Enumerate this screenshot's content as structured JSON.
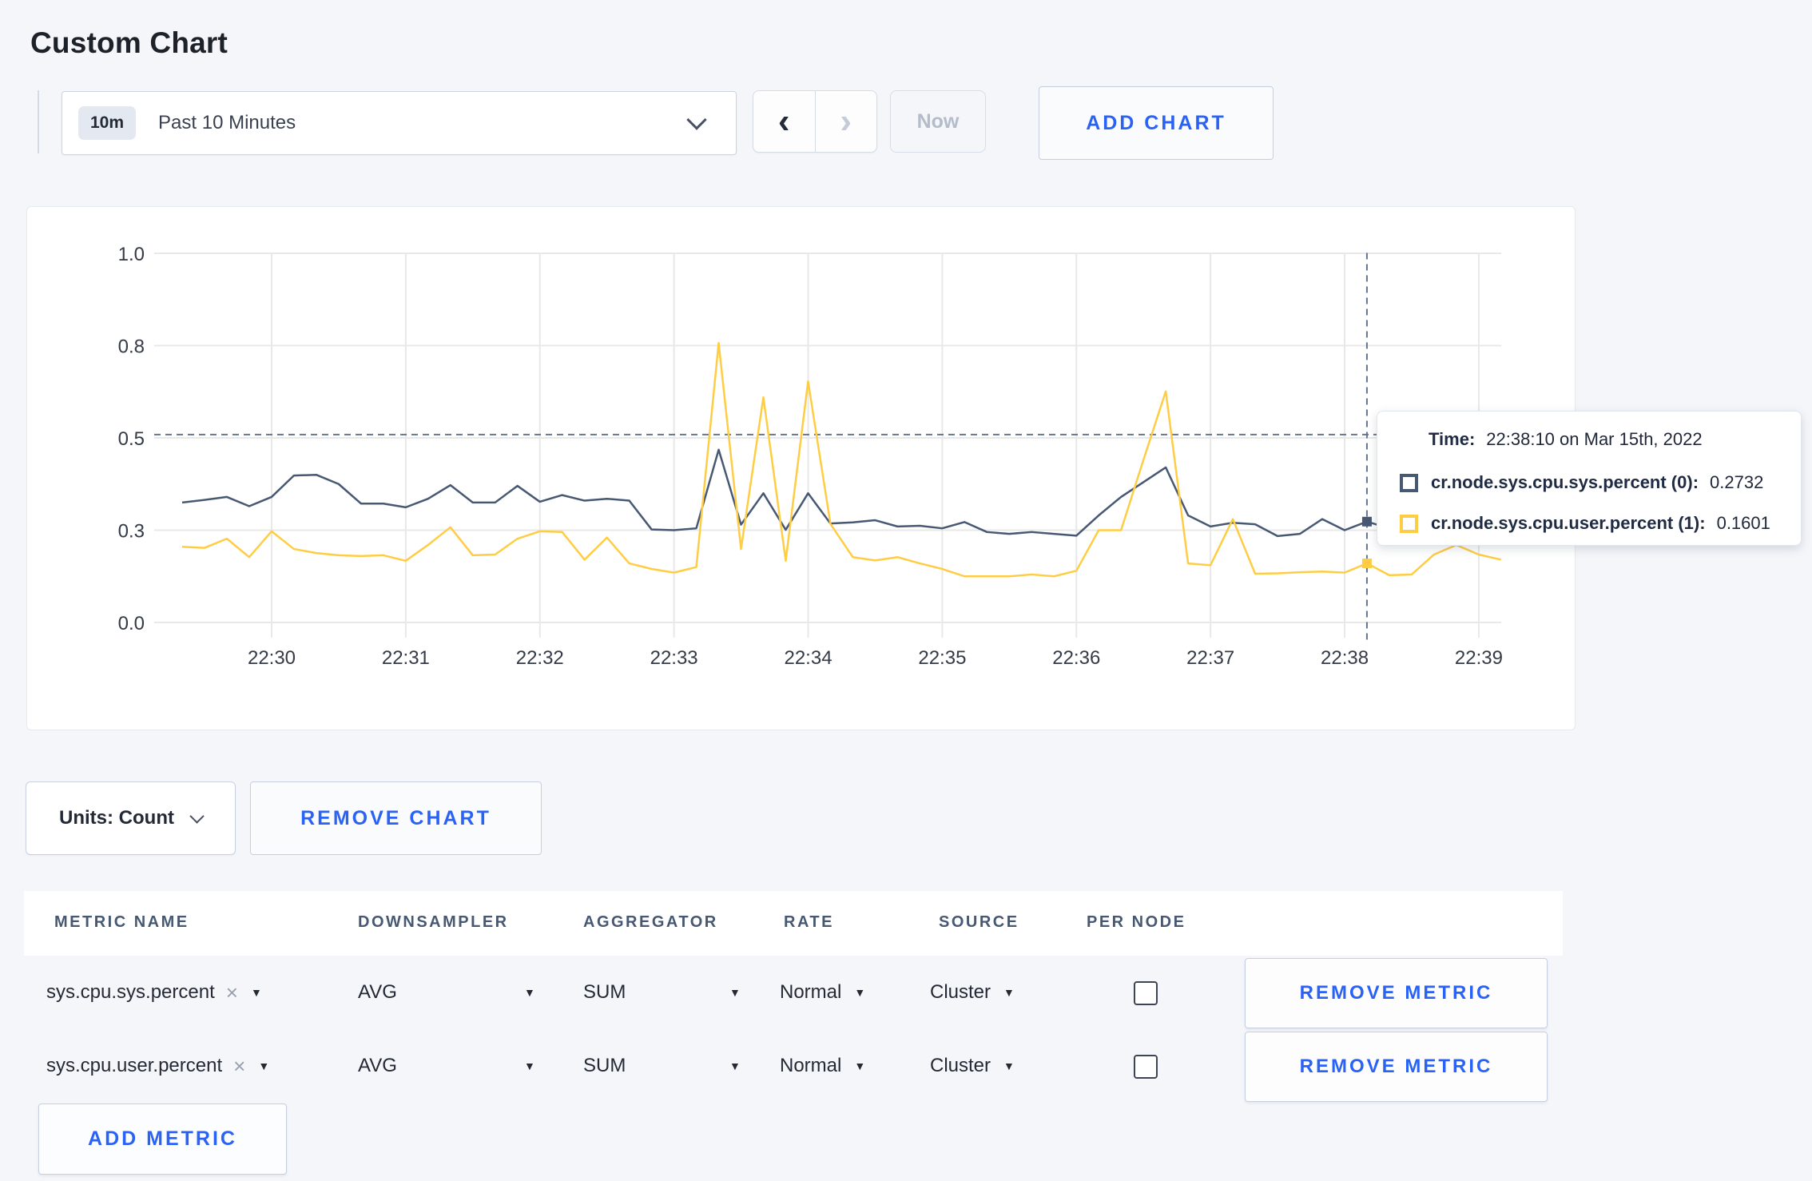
{
  "page": {
    "title": "Custom Chart"
  },
  "icons": {
    "prev": "‹",
    "next": "›",
    "caret": "▼",
    "close": "×"
  },
  "toolbar": {
    "time_badge": "10m",
    "time_label": "Past 10 Minutes",
    "now_label": "Now",
    "add_chart_label": "ADD CHART"
  },
  "chart_data": {
    "type": "line",
    "title": "",
    "x_start": "22:29:20",
    "x_step_seconds": 10,
    "x_tick_labels": [
      "22:30",
      "22:31",
      "22:32",
      "22:33",
      "22:34",
      "22:35",
      "22:36",
      "22:37",
      "22:38",
      "22:39"
    ],
    "y_tick_labels": [
      "0.0",
      "0.3",
      "0.5",
      "0.8",
      "1.0"
    ],
    "y_tick_values": [
      0,
      0.25,
      0.5,
      0.75,
      1.0
    ],
    "ylim": [
      0,
      1
    ],
    "grid": true,
    "legend_position": "none",
    "series": [
      {
        "name": "cr.node.sys.cpu.sys.percent (0)",
        "color": "#475872",
        "values": [
          0.325,
          0.332,
          0.34,
          0.315,
          0.34,
          0.398,
          0.4,
          0.375,
          0.322,
          0.322,
          0.312,
          0.335,
          0.372,
          0.325,
          0.325,
          0.37,
          0.327,
          0.345,
          0.33,
          0.335,
          0.33,
          0.252,
          0.25,
          0.255,
          0.468,
          0.265,
          0.35,
          0.251,
          0.35,
          0.268,
          0.271,
          0.277,
          0.26,
          0.262,
          0.255,
          0.272,
          0.245,
          0.24,
          0.245,
          0.24,
          0.235,
          0.29,
          0.34,
          0.38,
          0.42,
          0.29,
          0.26,
          0.27,
          0.266,
          0.234,
          0.24,
          0.28,
          0.25,
          0.2732,
          0.255,
          0.26,
          0.27,
          0.265,
          0.26,
          0.262
        ]
      },
      {
        "name": "cr.node.sys.cpu.user.percent (1)",
        "color": "#ffcd44",
        "values": [
          0.205,
          0.202,
          0.227,
          0.177,
          0.247,
          0.199,
          0.188,
          0.182,
          0.18,
          0.182,
          0.167,
          0.21,
          0.258,
          0.182,
          0.184,
          0.227,
          0.247,
          0.245,
          0.17,
          0.23,
          0.16,
          0.145,
          0.135,
          0.15,
          0.757,
          0.199,
          0.61,
          0.167,
          0.653,
          0.267,
          0.177,
          0.168,
          0.177,
          0.16,
          0.145,
          0.125,
          0.125,
          0.125,
          0.13,
          0.125,
          0.14,
          0.25,
          0.25,
          0.44,
          0.626,
          0.16,
          0.155,
          0.28,
          0.132,
          0.133,
          0.136,
          0.138,
          0.135,
          0.1601,
          0.128,
          0.13,
          0.184,
          0.21,
          0.184,
          0.17
        ]
      }
    ],
    "crosshair": {
      "x_index": 53,
      "y_value": 0.509,
      "time": "22:38:10"
    }
  },
  "tooltip": {
    "time_label": "Time:",
    "time_value": "22:38:10 on Mar 15th, 2022",
    "rows": [
      {
        "name": "cr.node.sys.cpu.sys.percent (0):",
        "value": "0.2732",
        "color": "#475872"
      },
      {
        "name": "cr.node.sys.cpu.user.percent (1):",
        "value": "0.1601",
        "color": "#ffcd44"
      }
    ]
  },
  "chart_controls": {
    "units_label": "Units: Count",
    "remove_chart_label": "REMOVE CHART",
    "add_metric_label": "ADD METRIC"
  },
  "metrics_table": {
    "headers": [
      "METRIC NAME",
      "DOWNSAMPLER",
      "AGGREGATOR",
      "RATE",
      "SOURCE",
      "PER NODE"
    ],
    "rows": [
      {
        "metric": "sys.cpu.sys.percent",
        "downsampler": "AVG",
        "aggregator": "SUM",
        "rate": "Normal",
        "source": "Cluster",
        "per_node_checked": false,
        "remove_label": "REMOVE METRIC"
      },
      {
        "metric": "sys.cpu.user.percent",
        "downsampler": "AVG",
        "aggregator": "SUM",
        "rate": "Normal",
        "source": "Cluster",
        "per_node_checked": false,
        "remove_label": "REMOVE METRIC"
      }
    ]
  }
}
